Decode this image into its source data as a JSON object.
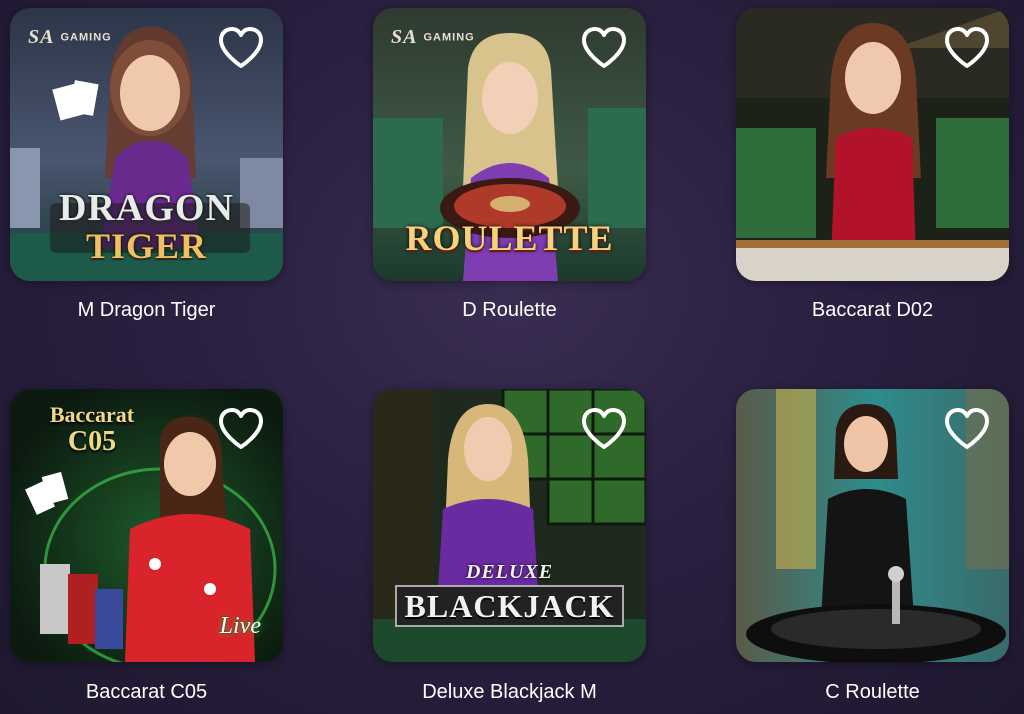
{
  "games": [
    {
      "title": "M Dragon Tiger",
      "brand": "GAMING",
      "brand_mark": "SA",
      "logo_line1": "DRAGON",
      "logo_line2": "TIGER",
      "favorite_icon": "heart-outline-icon"
    },
    {
      "title": "D Roulette",
      "brand": "GAMING",
      "brand_mark": "SA",
      "logo_line1": "ROULETTE",
      "favorite_icon": "heart-outline-icon"
    },
    {
      "title": "Baccarat D02",
      "favorite_icon": "heart-outline-icon"
    },
    {
      "title": "Baccarat C05",
      "badge_line1": "Baccarat",
      "badge_line2": "C05",
      "live_label": "Live",
      "favorite_icon": "heart-outline-icon"
    },
    {
      "title": "Deluxe Blackjack M",
      "logo_line1": "DELUXE",
      "logo_line2": "BLACKJACK",
      "favorite_icon": "heart-outline-icon"
    },
    {
      "title": "C Roulette",
      "favorite_icon": "heart-outline-icon"
    }
  ],
  "colors": {
    "background": "#2a2040",
    "title_text": "#ffffff",
    "heart_stroke": "#ffffff"
  }
}
